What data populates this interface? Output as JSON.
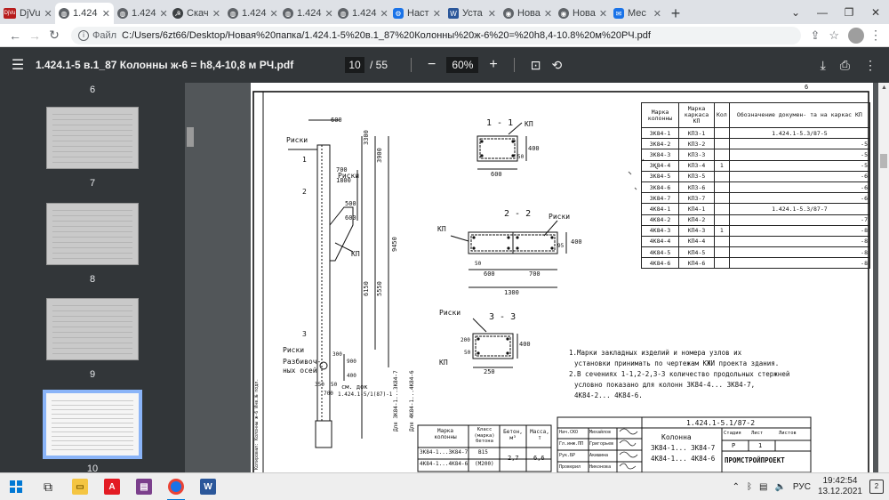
{
  "browser": {
    "tabs": [
      {
        "label": "DjVu",
        "icon": "djvu-icon",
        "active": false
      },
      {
        "label": "1.424",
        "icon": "globe-icon",
        "active": true
      },
      {
        "label": "1.424",
        "icon": "globe-icon",
        "active": false
      },
      {
        "label": "Скач",
        "icon": "hammer-sickle-icon",
        "active": false
      },
      {
        "label": "1.424",
        "icon": "globe-icon",
        "active": false
      },
      {
        "label": "1.424",
        "icon": "globe-icon",
        "active": false
      },
      {
        "label": "1.424",
        "icon": "globe-icon",
        "active": false
      },
      {
        "label": "Наст",
        "icon": "gear-icon",
        "active": false
      },
      {
        "label": "Уста",
        "icon": "word-icon",
        "active": false
      },
      {
        "label": "Нова",
        "icon": "chrome-icon",
        "active": false
      },
      {
        "label": "Нова",
        "icon": "chrome-icon",
        "active": false
      },
      {
        "label": "Мес",
        "icon": "messenger-icon",
        "active": false
      }
    ],
    "address": {
      "scheme": "Файл",
      "url": "C:/Users/6zt66/Desktop/Новая%20папка/1.424.1-5%20в.1_87%20Колонны%20ж-6%20=%20h8,4-10.8%20м%20РЧ.pdf"
    }
  },
  "pdf": {
    "title": "1.424.1-5 в.1_87 Колонны ж-6 = h8,4-10,8 м РЧ.pdf",
    "page_current": "10",
    "page_total": "/ 55",
    "zoom": "60%",
    "thumbnails": [
      {
        "label": "6"
      },
      {
        "label": "7"
      },
      {
        "label": "8"
      },
      {
        "label": "9"
      },
      {
        "label": "10"
      }
    ]
  },
  "drawing": {
    "page_number": "6",
    "dims_top": [
      "600",
      "700",
      "1800",
      "500",
      "600",
      "3300",
      "3900",
      "9450",
      "6150",
      "5550",
      "300",
      "900",
      "400",
      "700",
      "350",
      "50"
    ],
    "labels": {
      "riski": "Риски",
      "kp": "КП",
      "razbivochnye": "Разбивоч-",
      "osei": "ных осей",
      "sm_dok": "см. док",
      "sm_dok_num": "1.424.1-5/1(87)-1",
      "dlya1": "Для 3К84-1...3К84-7",
      "dlya2": "Для 4К84-1...4К84-6",
      "sec11": "1 - 1",
      "sec22": "2 - 2",
      "sec33": "3 - 3",
      "s11_w": "600",
      "s11_h": "400",
      "s11_a": "50",
      "s22_w1": "600",
      "s22_w2": "700",
      "s22_tot": "1300",
      "s22_a": "50",
      "s22_h": "400",
      "s22_b": "95",
      "s33_w": "250",
      "s33_h": "400",
      "s33_a": "200",
      "s33_b": "50",
      "mark1": "1",
      "mark2": "2",
      "mark3": "3",
      "sideways_stamp": "Копировал: Колонны ж-6 Инв.№ подл."
    },
    "spec_table": {
      "headers": [
        "Марка колонны",
        "Марка каркаса КП",
        "Кол",
        "Обозначение докумен- та на каркас КП"
      ],
      "rows": [
        [
          "3К84-1",
          "КП3-1",
          "",
          "1.424.1-5.3/87-5"
        ],
        [
          "3К84-2",
          "КП3-2",
          "",
          "-5"
        ],
        [
          "3К84-3",
          "КП3-3",
          "",
          "-5"
        ],
        [
          "3К84-4",
          "КП3-4",
          "1",
          "-5"
        ],
        [
          "3К84-5",
          "КП3-5",
          "",
          "-6"
        ],
        [
          "3К84-6",
          "КП3-6",
          "",
          "-6"
        ],
        [
          "3К84-7",
          "КП3-7",
          "",
          "-6"
        ],
        [
          "4К84-1",
          "КП4-1",
          "",
          "1.424.1-5.3/87-7"
        ],
        [
          "4К84-2",
          "КП4-2",
          "",
          "-7"
        ],
        [
          "4К84-3",
          "КП4-3",
          "1",
          "-8"
        ],
        [
          "4К84-4",
          "КП4-4",
          "",
          "-8"
        ],
        [
          "4К84-5",
          "КП4-5",
          "",
          "-8"
        ],
        [
          "4К84-6",
          "КП4-6",
          "",
          "-8"
        ]
      ]
    },
    "notes": [
      "1.Марки закладных изделий и номера узлов их",
      "установки принимать по чертежам КЖИ проекта здания.",
      "2.В сечениях 1-1,2-2,3-3 количество продольных стержней",
      "условно показано для колонн 3К84-4... 3К84-7,",
      "4К84-2... 4К84-6."
    ],
    "concrete_table": {
      "headers": [
        "Марка колонны",
        "Класс (марка) бетона",
        "Бетон, м³",
        "Масса, т"
      ],
      "row1": [
        "3К84-1...3К84-7",
        "В15",
        "",
        ""
      ],
      "row1b": [
        "",
        "(М200)",
        "2,7",
        "6,6"
      ],
      "row2": [
        "4К84-1...4К84-6",
        "",
        "",
        ""
      ]
    },
    "title_block": {
      "code": "1.424.1-5.1/87-2",
      "name1": "Колонна",
      "name2": "3К84-1... 3К84-7",
      "name3": "4К84-1... 4К84-6",
      "stage_hdr": "Стадия",
      "sheet_hdr": "Лист",
      "sheets_hdr": "Листов",
      "stage": "Р",
      "sheet": "1",
      "org": "ПРОМСТРОЙПРОЕКТ",
      "people": [
        [
          "Нач.СКО",
          "Михайлов"
        ],
        [
          "Гл.инж.ПП",
          "Григорьев"
        ],
        [
          "Рук.БР",
          "Акишина"
        ],
        [
          "Проверил",
          "Никонова"
        ]
      ]
    }
  },
  "taskbar": {
    "lang": "РУС",
    "time": "19:42:54",
    "date": "13.12.2021",
    "notif_count": "2"
  }
}
